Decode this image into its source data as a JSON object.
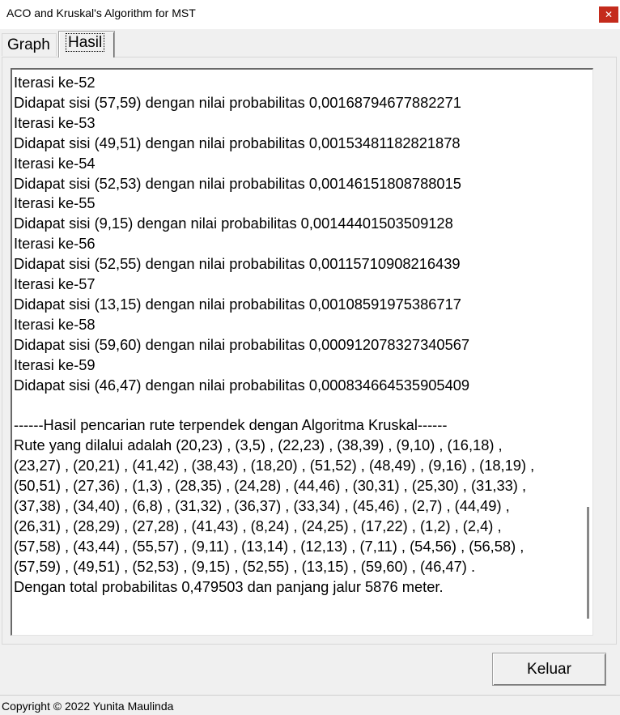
{
  "window": {
    "title": "ACO and Kruskal's Algorithm for MST",
    "close_glyph": "✕"
  },
  "tabs": [
    {
      "label": "Graph",
      "selected": false
    },
    {
      "label": "Hasil",
      "selected": true
    }
  ],
  "output": {
    "lines": [
      "Iterasi ke-52",
      "Didapat sisi (57,59) dengan nilai probabilitas 0,00168794677882271",
      "Iterasi ke-53",
      "Didapat sisi (49,51) dengan nilai probabilitas 0,00153481182821878",
      "Iterasi ke-54",
      "Didapat sisi (52,53) dengan nilai probabilitas 0,00146151808788015",
      "Iterasi ke-55",
      "Didapat sisi (9,15) dengan nilai probabilitas 0,00144401503509128",
      "Iterasi ke-56",
      "Didapat sisi (52,55) dengan nilai probabilitas 0,00115710908216439",
      "Iterasi ke-57",
      "Didapat sisi (13,15) dengan nilai probabilitas 0,00108591975386717",
      "Iterasi ke-58",
      "Didapat sisi (59,60) dengan nilai probabilitas 0,000912078327340567",
      "Iterasi ke-59",
      "Didapat sisi (46,47) dengan nilai probabilitas 0,000834664535905409",
      "",
      "------Hasil pencarian rute terpendek dengan Algoritma Kruskal------",
      "Rute yang dilalui adalah (20,23) , (3,5) , (22,23) , (38,39) , (9,10) , (16,18) ,",
      "(23,27) , (20,21) , (41,42) , (38,43) , (18,20) , (51,52) , (48,49) , (9,16) , (18,19) ,",
      "(50,51) , (27,36) , (1,3) , (28,35) , (24,28) , (44,46) , (30,31) , (25,30) , (31,33) ,",
      "(37,38) , (34,40) , (6,8) , (31,32) , (36,37) , (33,34) , (45,46) , (2,7) , (44,49) ,",
      "(26,31) , (28,29) , (27,28) , (41,43) , (8,24) , (24,25) , (17,22) , (1,2) , (2,4) ,",
      "(57,58) , (43,44) , (55,57) , (9,11) , (13,14) , (12,13) , (7,11) , (54,56) , (56,58) ,",
      "(57,59) , (49,51) , (52,53) , (9,15) , (52,55) , (13,15) , (59,60) , (46,47) .",
      "Dengan total probabilitas 0,479503 dan panjang jalur 5876 meter."
    ]
  },
  "buttons": {
    "keluar_label": "Keluar"
  },
  "status": {
    "copyright": "Copyright © 2022 Yunita Maulinda"
  }
}
